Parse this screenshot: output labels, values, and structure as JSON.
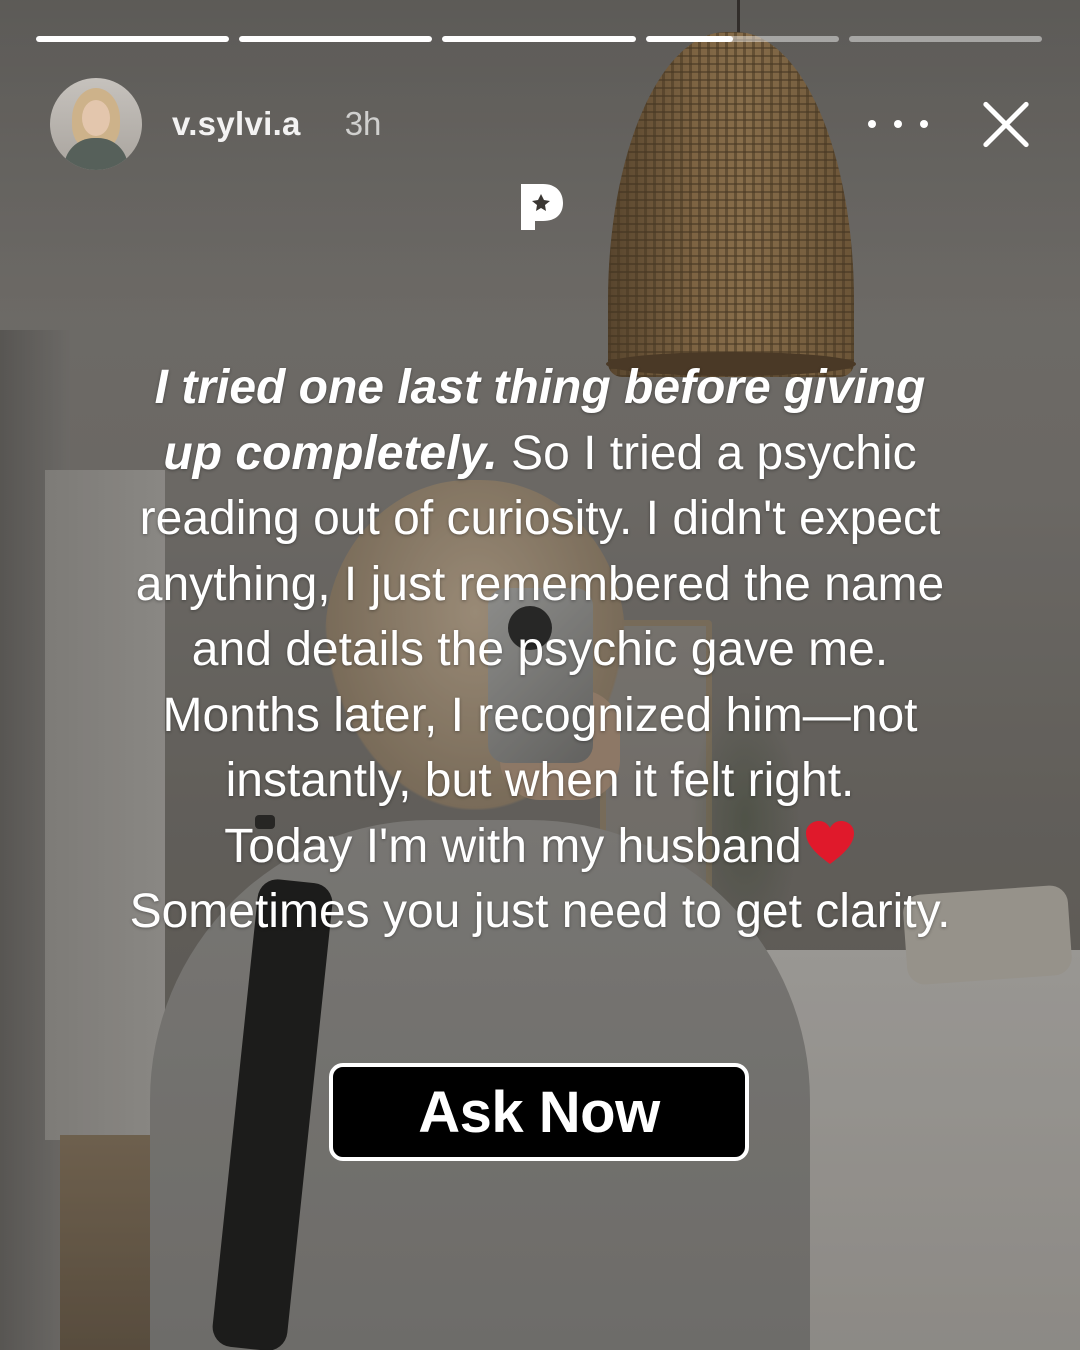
{
  "story": {
    "progress_segments": [
      1,
      1,
      1,
      0.45,
      0
    ],
    "username": "v.sylvi.a",
    "time_ago": "3h",
    "more_icon": "more-horizontal-icon",
    "close_icon": "close-icon",
    "brand_icon": "brand-logo-icon"
  },
  "caption": {
    "line1": "I tried one last thing before giving",
    "line2_em": "up completely.",
    "line2_rest": " So I tried a psychic",
    "line3": "reading out of curiosity. I didn't expect",
    "line4": "anything, I just remembered the name",
    "line5": "and details the psychic gave me.",
    "line6": "Months later, I recognized him—not",
    "line7": "instantly, but when it felt right.",
    "line8": "Today I'm with my husband",
    "line8_icon": "red-heart-icon",
    "line9": "Sometimes you just need to get clarity."
  },
  "cta": {
    "label": "Ask Now"
  },
  "colors": {
    "text": "#ffffff",
    "cta_bg": "#000000",
    "cta_border": "#ffffff",
    "heart": "#e0192b"
  }
}
